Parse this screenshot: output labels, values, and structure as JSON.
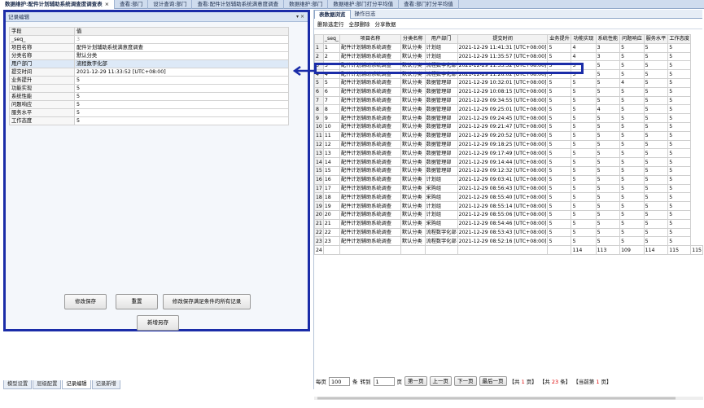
{
  "doc_tabs": [
    {
      "label": "数据维护:配件计划辅助系统调查度调查表",
      "active": true,
      "closable": true
    },
    {
      "label": "查看:部门",
      "active": false
    },
    {
      "label": "设计查询:部门",
      "active": false
    },
    {
      "label": "查看:配件计划辅助系统满意度调查",
      "active": false
    },
    {
      "label": "数据维护:部门",
      "active": false
    },
    {
      "label": "数据维护:部门打分平均值",
      "active": false
    },
    {
      "label": "查看:部门打分平均值",
      "active": false
    }
  ],
  "left_panel": {
    "title": "记录编辑",
    "pin": "▾ ×",
    "header": {
      "field": "字段",
      "value": "值"
    },
    "fields": [
      {
        "name": "_seq_",
        "value": "3",
        "faint": true
      },
      {
        "name": "项目名称",
        "value": "配件计划辅助系统满意度调查"
      },
      {
        "name": "分类名称",
        "value": "默认分类"
      },
      {
        "name": "用户部门",
        "value": "流程数字化部"
      },
      {
        "name": "提交时间",
        "value": "2021-12-29 11:33:52 [UTC+08:00]"
      },
      {
        "name": "业务提升",
        "value": "5"
      },
      {
        "name": "功能实现",
        "value": "5"
      },
      {
        "name": "系统性能",
        "value": "5"
      },
      {
        "name": "问题响应",
        "value": "5"
      },
      {
        "name": "服务水平",
        "value": "5"
      },
      {
        "name": "工作态度",
        "value": "5"
      }
    ],
    "buttons": {
      "save": "修改保存",
      "reset": "重置",
      "save_all": "修改保存满足条件的所有记录",
      "save_new": "新增另存"
    },
    "bottom_tabs": [
      {
        "label": "模型设置",
        "active": false
      },
      {
        "label": "层级配置",
        "active": false
      },
      {
        "label": "记录编辑",
        "active": true
      },
      {
        "label": "记录新增",
        "active": false
      }
    ]
  },
  "right_panel": {
    "tabs": [
      {
        "label": "表数据浏览",
        "active": true
      },
      {
        "label": "操作日志",
        "active": false
      }
    ],
    "toolbar": {
      "delete_selected": "删除选定行",
      "delete_all": "全部删除",
      "share": "分享数据"
    },
    "columns": [
      "_seq_",
      "项目名称",
      "分类名称",
      "用户部门",
      "提交时间",
      "业务提升",
      "功能实现",
      "系统性能",
      "问题响应",
      "服务水平",
      "工作态度"
    ],
    "rows": [
      [
        "1",
        "1",
        "配件计划辅助系统调查",
        "默认分类",
        "计划组",
        "2021-12-29 11:41:31 [UTC+08:00]",
        "5",
        "4",
        "3",
        "5",
        "5",
        "5"
      ],
      [
        "2",
        "2",
        "配件计划辅助系统调查",
        "默认分类",
        "计划组",
        "2021-12-29 11:35:57 [UTC+08:00]",
        "5",
        "4",
        "3",
        "5",
        "5",
        "5"
      ],
      [
        "3",
        "3",
        "配件计划辅助系统调查",
        "默认分类",
        "流程数字化部",
        "2021-12-29 11:33:52 [UTC+08:00]",
        "5",
        "5",
        "5",
        "5",
        "5",
        "5"
      ],
      [
        "4",
        "4",
        "配件计划辅助系统调查",
        "默认分类",
        "流程数字化部",
        "2021-12-29 11:26:02 [UTC+08:00]",
        "5",
        "5",
        "5",
        "5",
        "5",
        "5"
      ],
      [
        "5",
        "5",
        "配件计划辅助系统调查",
        "默认分类",
        "数据管理部",
        "2021-12-29 10:32:01 [UTC+08:00]",
        "5",
        "5",
        "5",
        "4",
        "5",
        "5"
      ],
      [
        "6",
        "6",
        "配件计划辅助系统调查",
        "默认分类",
        "数据管理部",
        "2021-12-29 10:08:15 [UTC+08:00]",
        "5",
        "5",
        "5",
        "5",
        "5",
        "5"
      ],
      [
        "7",
        "7",
        "配件计划辅助系统调查",
        "默认分类",
        "数据管理部",
        "2021-12-29 09:34:55 [UTC+08:00]",
        "5",
        "5",
        "5",
        "5",
        "5",
        "5"
      ],
      [
        "8",
        "8",
        "配件计划辅助系统调查",
        "默认分类",
        "数据管理部",
        "2021-12-29 09:25:01 [UTC+08:00]",
        "5",
        "5",
        "4",
        "5",
        "5",
        "5"
      ],
      [
        "9",
        "9",
        "配件计划辅助系统调查",
        "默认分类",
        "数据管理部",
        "2021-12-29 09:24:45 [UTC+08:00]",
        "5",
        "5",
        "5",
        "5",
        "5",
        "5"
      ],
      [
        "10",
        "10",
        "配件计划辅助系统调查",
        "默认分类",
        "数据管理部",
        "2021-12-29 09:21:47 [UTC+08:00]",
        "5",
        "5",
        "5",
        "5",
        "5",
        "5"
      ],
      [
        "11",
        "11",
        "配件计划辅助系统调查",
        "默认分类",
        "数据管理部",
        "2021-12-29 09:20:52 [UTC+08:00]",
        "5",
        "5",
        "5",
        "5",
        "5",
        "5"
      ],
      [
        "12",
        "12",
        "配件计划辅助系统调查",
        "默认分类",
        "数据管理部",
        "2021-12-29 09:18:25 [UTC+08:00]",
        "5",
        "5",
        "5",
        "5",
        "5",
        "5"
      ],
      [
        "13",
        "13",
        "配件计划辅助系统调查",
        "默认分类",
        "数据管理部",
        "2021-12-29 09:17:49 [UTC+08:00]",
        "5",
        "5",
        "5",
        "5",
        "5",
        "5"
      ],
      [
        "14",
        "14",
        "配件计划辅助系统调查",
        "默认分类",
        "数据管理部",
        "2021-12-29 09:14:44 [UTC+08:00]",
        "5",
        "5",
        "5",
        "5",
        "5",
        "5"
      ],
      [
        "15",
        "15",
        "配件计划辅助系统调查",
        "默认分类",
        "数据管理部",
        "2021-12-29 09:12:32 [UTC+08:00]",
        "5",
        "5",
        "5",
        "5",
        "5",
        "5"
      ],
      [
        "16",
        "16",
        "配件计划辅助系统调查",
        "默认分类",
        "计划组",
        "2021-12-29 09:03:41 [UTC+08:00]",
        "5",
        "5",
        "5",
        "5",
        "5",
        "5"
      ],
      [
        "17",
        "17",
        "配件计划辅助系统调查",
        "默认分类",
        "采购组",
        "2021-12-29 08:56:43 [UTC+08:00]",
        "5",
        "5",
        "5",
        "5",
        "5",
        "5"
      ],
      [
        "18",
        "18",
        "配件计划辅助系统调查",
        "默认分类",
        "采购组",
        "2021-12-29 08:55:40 [UTC+08:00]",
        "5",
        "5",
        "5",
        "5",
        "5",
        "5"
      ],
      [
        "19",
        "19",
        "配件计划辅助系统调查",
        "默认分类",
        "计划组",
        "2021-12-29 08:55:14 [UTC+08:00]",
        "5",
        "5",
        "5",
        "5",
        "5",
        "5"
      ],
      [
        "20",
        "20",
        "配件计划辅助系统调查",
        "默认分类",
        "计划组",
        "2021-12-29 08:55:06 [UTC+08:00]",
        "5",
        "5",
        "5",
        "5",
        "5",
        "5"
      ],
      [
        "21",
        "21",
        "配件计划辅助系统调查",
        "默认分类",
        "采购组",
        "2021-12-29 08:54:46 [UTC+08:00]",
        "5",
        "5",
        "5",
        "5",
        "5",
        "5"
      ],
      [
        "22",
        "22",
        "配件计划辅助系统调查",
        "默认分类",
        "流程数字化部",
        "2021-12-29 08:53:43 [UTC+08:00]",
        "5",
        "5",
        "5",
        "5",
        "5",
        "5"
      ],
      [
        "23",
        "23",
        "配件计划辅助系统调查",
        "默认分类",
        "流程数字化部",
        "2021-12-29 08:52:16 [UTC+08:00]",
        "5",
        "5",
        "5",
        "5",
        "5",
        "5"
      ]
    ],
    "totals": {
      "rn": "24",
      "values": [
        "114",
        "113",
        "109",
        "114",
        "115",
        "115"
      ]
    },
    "pager": {
      "per_page_label": "每页",
      "per_page": "100",
      "unit": "条",
      "goto_label": "转到",
      "goto_page": "1",
      "page_unit": "页",
      "first": "第一页",
      "prev": "上一页",
      "next": "下一页",
      "last": "最后一页",
      "total_pages_prefix": "【共",
      "total_pages": "1",
      "total_pages_suffix": "页】",
      "total_rows_prefix": "【共",
      "total_rows": "23",
      "total_rows_suffix": "条】",
      "current_prefix": "【当前第",
      "current": "1",
      "current_suffix": "页】"
    }
  }
}
